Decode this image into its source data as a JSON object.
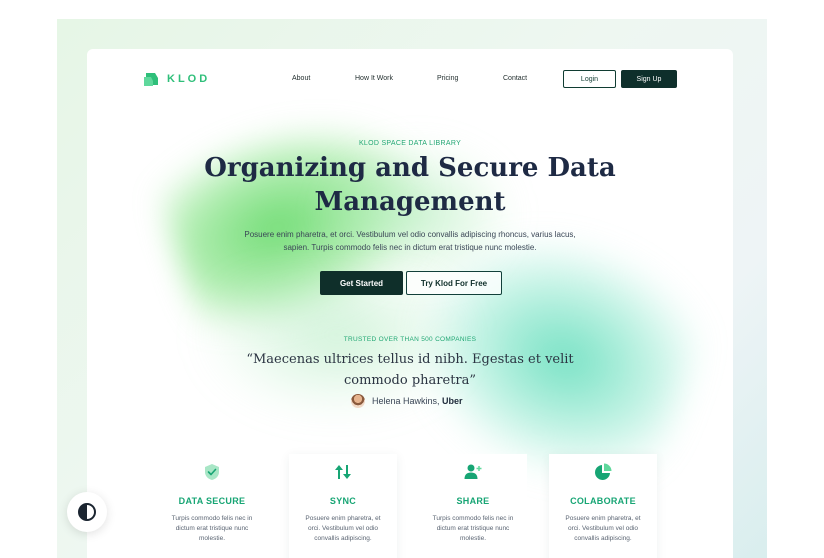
{
  "brand": {
    "name": "KLOD",
    "accent": "#2fbf7a",
    "dark": "#0e2f2b"
  },
  "nav": {
    "links": [
      "About",
      "How It Work",
      "Pricing",
      "Contact"
    ],
    "login": "Login",
    "signup": "Sign Up"
  },
  "hero": {
    "eyebrow": "KLOD SPACE DATA LIBRARY",
    "title": "Organizing and Secure Data Management",
    "description": "Posuere enim pharetra, et orci. Vestibulum vel odio convallis adipiscing rhoncus, varius lacus, sapien. Turpis commodo felis nec in dictum erat tristique nunc molestie.",
    "cta_primary": "Get Started",
    "cta_secondary": "Try Klod For Free"
  },
  "testimonial": {
    "eyebrow": "TRUSTED OVER THAN 500 COMPANIES",
    "quote": "“Maecenas ultrices tellus id nibh. Egestas et velit commodo pharetra”",
    "author": "Helena Hawkins",
    "company": "Uber"
  },
  "features": [
    {
      "icon": "shield-check-icon",
      "title": "DATA SECURE",
      "desc": "Turpis commodo felis nec in dictum erat tristique nunc molestie."
    },
    {
      "icon": "sync-icon",
      "title": "SYNC",
      "desc": "Posuere enim pharetra, et orci. Vestibulum vel odio convallis adipiscing."
    },
    {
      "icon": "share-user-icon",
      "title": "SHARE",
      "desc": "Turpis commodo felis nec in dictum erat tristique nunc molestie."
    },
    {
      "icon": "pie-chart-icon",
      "title": "COLABORATE",
      "desc": "Posuere enim pharetra, et orci. Vestibulum vel odio convallis adipiscing."
    }
  ],
  "theme_toggle": {
    "icon": "contrast-icon"
  }
}
